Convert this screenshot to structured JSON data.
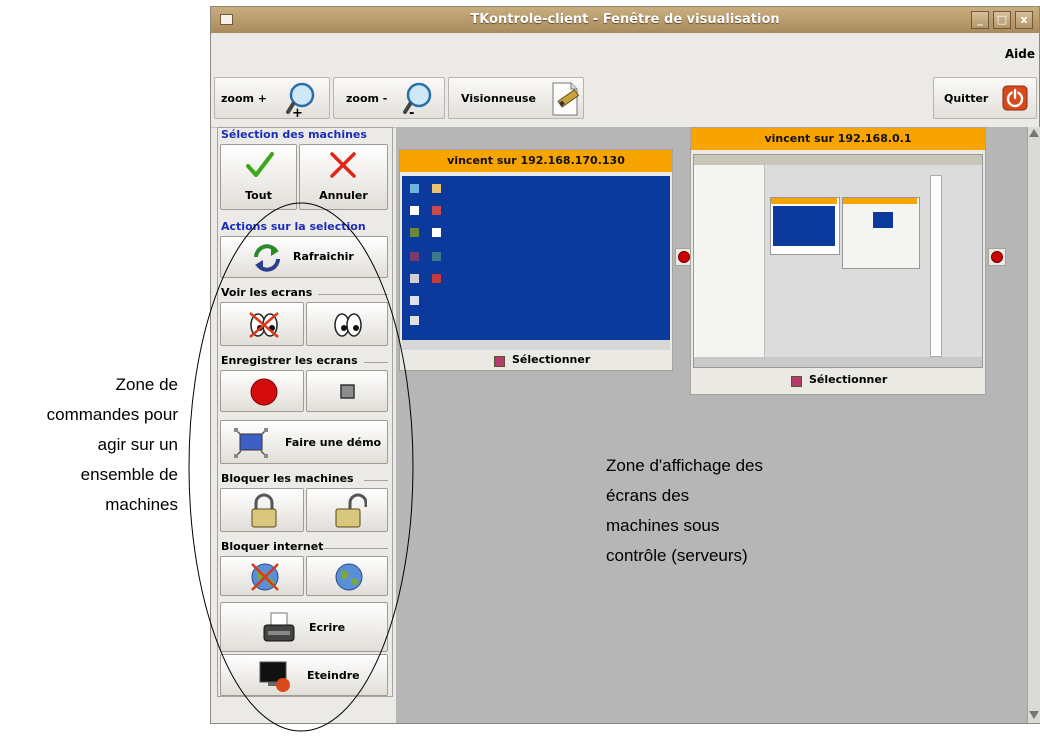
{
  "window": {
    "title": "TKontrole-client  - Fenêtre de visualisation",
    "controls": [
      "_",
      "□",
      "x"
    ]
  },
  "menubar": {
    "help": "Aide"
  },
  "toolbar": {
    "zoom_in": "zoom +",
    "zoom_out": "zoom -",
    "viewer": "Visionneuse",
    "quit": "Quitter"
  },
  "panel": {
    "selection_title": "Sélection des machines",
    "select_all": "Tout",
    "cancel": "Annuler",
    "actions_title": "Actions sur la selection",
    "refresh": "Rafraichir",
    "view_screens": "Voir les ecrans",
    "record_screens": "Enregistrer les ecrans",
    "demo": "Faire une démo",
    "lock_machines": "Bloquer les machines",
    "lock_internet": "Bloquer internet",
    "write": "Ecrire",
    "shutdown": "Eteindre"
  },
  "clients": [
    {
      "title": "vincent sur 192.168.170.130",
      "select_label": "Sélectionner"
    },
    {
      "title": "vincent sur 192.168.0.1",
      "select_label": "Sélectionner"
    }
  ],
  "annotations": {
    "left": [
      "Zone de",
      "commandes pour",
      "agir sur un",
      "ensemble de",
      "machines"
    ],
    "right": [
      "Zone d'affichage des",
      "écrans des",
      "machines sous",
      "contrôle (serveurs)"
    ]
  },
  "colors": {
    "titlebar": "#b89a6c",
    "card_header": "#f8a400",
    "remote_desktop": "#0b3a9c",
    "section_title": "#1b2db8",
    "quit_icon": "#d84a1b"
  },
  "icons": [
    "zoom-in-icon",
    "zoom-out-icon",
    "viewer-icon",
    "quit-power-icon",
    "checkmark-icon",
    "red-x-icon",
    "refresh-arrows-icon",
    "eyes-crossed-icon",
    "eyes-icon",
    "record-dot-icon",
    "stop-square-icon",
    "demo-screen-icon",
    "lock-closed-icon",
    "lock-open-icon",
    "globe-crossed-icon",
    "globe-icon",
    "typewriter-icon",
    "shutdown-monitor-icon"
  ]
}
